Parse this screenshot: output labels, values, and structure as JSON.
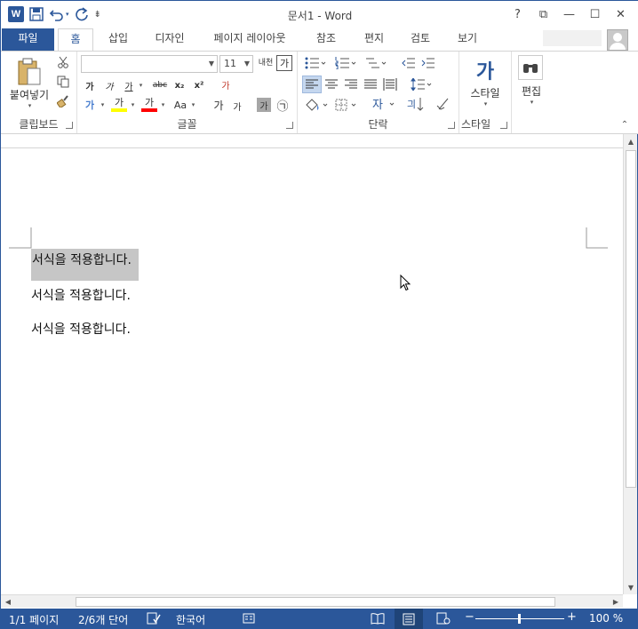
{
  "window": {
    "title": "문서1 - Word",
    "controls": {
      "help": "?",
      "restore_ribbon": "⧉",
      "minimize": "—",
      "maximize": "☐",
      "close": "✕"
    }
  },
  "qat": {
    "app_icon": "W",
    "save_icon": "save-icon",
    "undo_icon": "undo-icon",
    "redo_icon": "redo-icon",
    "customize_icon": "customize-icon"
  },
  "tabs": [
    {
      "label": "파일"
    },
    {
      "label": "홈"
    },
    {
      "label": "삽입"
    },
    {
      "label": "디자인"
    },
    {
      "label": "페이지 레이아웃"
    },
    {
      "label": "참조"
    },
    {
      "label": "편지"
    },
    {
      "label": "검토"
    },
    {
      "label": "보기"
    }
  ],
  "ribbon": {
    "clipboard": {
      "label": "클립보드",
      "paste": "붙여넣기"
    },
    "font": {
      "label": "글꼴",
      "font_name": "",
      "font_size": "11",
      "bold": "가",
      "italic": "가",
      "underline": "가",
      "strike": "abc",
      "subscript": "x₂",
      "superscript": "x²",
      "text_effects": "가",
      "highlight": "가",
      "font_color": "가",
      "change_case": "Aa",
      "grow": "가",
      "shrink": "가",
      "char_shade": "가",
      "enclose": "㉠",
      "phonetic": "내천",
      "char_border": "가",
      "clear": "가"
    },
    "paragraph": {
      "label": "단락"
    },
    "styles": {
      "label": "스타일",
      "button": "스타일",
      "icon": "가"
    },
    "editing": {
      "label": "편집",
      "button": "편집"
    }
  },
  "document": {
    "lines": [
      "서식을 적용합니다.",
      "서식을 적용합니다.",
      "서식을 적용합니다."
    ]
  },
  "status": {
    "page": "1/1 페이지",
    "words": "2/6개 단어",
    "language": "한국어",
    "zoom": "100 %",
    "zoom_minus": "−",
    "zoom_plus": "+"
  },
  "colors": {
    "accent": "#2b579a",
    "highlight_bar": "#ffff00",
    "font_color_bar": "#ff0000"
  }
}
